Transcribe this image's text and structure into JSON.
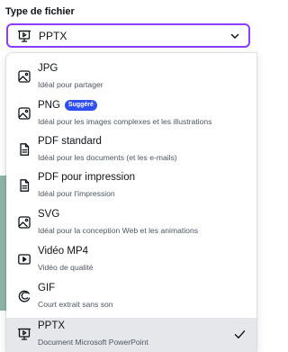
{
  "field_label": "Type de fichier",
  "select": {
    "value": "PPTX",
    "icon": "presentation-icon"
  },
  "accent_color": "#8b3dff",
  "badge_color": "#2f4ef0",
  "options": [
    {
      "title": "JPG",
      "desc": "Idéal pour partager",
      "icon": "image-icon"
    },
    {
      "title": "PNG",
      "badge": "Suggéré",
      "desc": "Idéal pour les images complexes et les illustrations",
      "icon": "image-icon"
    },
    {
      "title": "PDF standard",
      "desc": "Idéal pour les documents (et les e-mails)",
      "icon": "document-icon"
    },
    {
      "title": "PDF pour impression",
      "desc": "Idéal pour l'impression",
      "icon": "document-icon"
    },
    {
      "title": "SVG",
      "desc": "Idéal pour la conception Web et les animations",
      "icon": "image-icon"
    },
    {
      "title": "Vidéo MP4",
      "desc": "Vidéo de qualité",
      "icon": "video-icon"
    },
    {
      "title": "GIF",
      "desc": "Court extrait sans son",
      "icon": "gif-icon"
    },
    {
      "title": "PPTX",
      "desc": "Document Microsoft PowerPoint",
      "icon": "presentation-icon",
      "selected": true
    }
  ]
}
